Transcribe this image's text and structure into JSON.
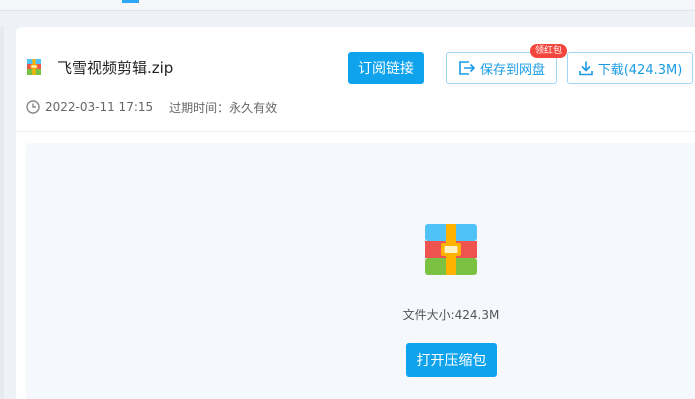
{
  "file": {
    "name": "飞雪视频剪辑.zip",
    "date": "2022-03-11 17:15",
    "expiry": "过期时间：永久有效"
  },
  "actions": {
    "subscribe_label": "订阅链接",
    "save_label": "保存到网盘",
    "save_badge": "领红包",
    "download_label": "下载(424.3M)"
  },
  "preview": {
    "file_size": "文件大小:424.3M",
    "open_label": "打开压缩包"
  },
  "colors": {
    "accent": "#0fa3ee",
    "badge": "#f4463c",
    "preview_bg": "#f5f8fd"
  },
  "icons": {
    "file": "archive-icon",
    "clock": "clock-icon",
    "save": "save-to-cloud-icon",
    "download": "download-icon"
  }
}
